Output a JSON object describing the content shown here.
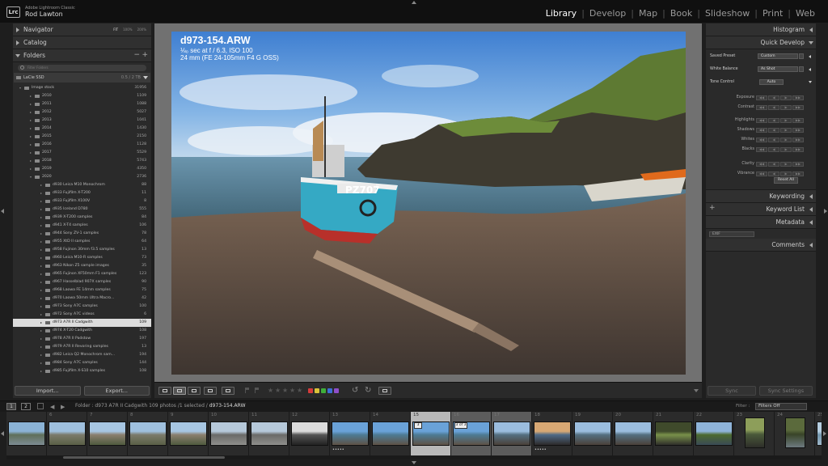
{
  "app": {
    "logo": "Lrc",
    "name": "Adobe Lightroom Classic",
    "user": "Rod Lawton"
  },
  "modules": [
    "Library",
    "Develop",
    "Map",
    "Book",
    "Slideshow",
    "Print",
    "Web"
  ],
  "active_module": "Library",
  "left_panel": {
    "navigator": {
      "label": "Navigator",
      "zoom_options": [
        "FIT",
        "100%",
        "200%"
      ]
    },
    "catalog": {
      "label": "Catalog"
    },
    "folders": {
      "label": "Folders",
      "add": "+",
      "remove": "−",
      "search_placeholder": "Filter Folders"
    },
    "drive": {
      "name": "LaCie SSD",
      "capacity": "0.5 / 2 TB"
    },
    "folder_rows": [
      {
        "name": "Image stock",
        "count": "31956",
        "depth": 1,
        "open": true
      },
      {
        "name": "2010",
        "count": "1109",
        "depth": 2
      },
      {
        "name": "2011",
        "count": "1088",
        "depth": 2
      },
      {
        "name": "2012",
        "count": "5027",
        "depth": 2
      },
      {
        "name": "2013",
        "count": "1041",
        "depth": 2
      },
      {
        "name": "2014",
        "count": "1430",
        "depth": 2
      },
      {
        "name": "2015",
        "count": "2150",
        "depth": 2
      },
      {
        "name": "2016",
        "count": "1128",
        "depth": 2
      },
      {
        "name": "2017",
        "count": "5529",
        "depth": 2
      },
      {
        "name": "2018",
        "count": "5743",
        "depth": 2
      },
      {
        "name": "2019",
        "count": "4350",
        "depth": 2
      },
      {
        "name": "2020",
        "count": "2736",
        "depth": 2,
        "open": true
      },
      {
        "name": "d930 Leica M10 Monochrom",
        "count": "88",
        "depth": 3
      },
      {
        "name": "d933 Fujifilm X-T200",
        "count": "11",
        "depth": 3
      },
      {
        "name": "d933 Fujifilm X100V",
        "count": "8",
        "depth": 3
      },
      {
        "name": "d935 Iceland D780",
        "count": "555",
        "depth": 3
      },
      {
        "name": "d939 X-T200 samples",
        "count": "84",
        "depth": 3
      },
      {
        "name": "d941 X-T4 samples",
        "count": "106",
        "depth": 3
      },
      {
        "name": "d944 Sony ZV-1 samples",
        "count": "78",
        "depth": 3
      },
      {
        "name": "d955 XtD II samples",
        "count": "64",
        "depth": 3
      },
      {
        "name": "d958 Fujinon 30mm f3.5 samples",
        "count": "13",
        "depth": 3
      },
      {
        "name": "d960 Leica M10-R samples",
        "count": "73",
        "depth": 3
      },
      {
        "name": "d963 Nikon Z5 sample images",
        "count": "35",
        "depth": 3
      },
      {
        "name": "d965 Fujinon XF50mm F1 samples",
        "count": "123",
        "depth": 3
      },
      {
        "name": "d967 Hasselblad 907X samples",
        "count": "90",
        "depth": 3
      },
      {
        "name": "d968 Laowa FE 14mm samples",
        "count": "75",
        "depth": 3
      },
      {
        "name": "d970 Laowa 50mm Ultra Macro...",
        "count": "42",
        "depth": 3
      },
      {
        "name": "d973 Sony A7C samples",
        "count": "100",
        "depth": 3
      },
      {
        "name": "d972 Sony A7C videos",
        "count": "6",
        "depth": 3
      },
      {
        "name": "d973 A7R II Cadgwith",
        "count": "109",
        "depth": 3,
        "selected": true
      },
      {
        "name": "d974 X-T20 Cadgwith",
        "count": "108",
        "depth": 3
      },
      {
        "name": "d978 A7R II Padstow",
        "count": "197",
        "depth": 3
      },
      {
        "name": "d979 A7R II Revoring samples",
        "count": "13",
        "depth": 3
      },
      {
        "name": "d982 Leica Q2 Monochrom sam...",
        "count": "194",
        "depth": 3
      },
      {
        "name": "d984 Sony A7C samples",
        "count": "144",
        "depth": 3
      },
      {
        "name": "d985 Fujifilm X-S10 samples",
        "count": "108",
        "depth": 3
      }
    ],
    "import_label": "Import...",
    "export_label": "Export..."
  },
  "loupe": {
    "filename": "d973-154.ARW",
    "exposure": "⅛₀ sec at f / 6.3, ISO 100",
    "lens": "24 mm (FE 24-105mm F4 G OSS)"
  },
  "toolbar": {
    "color_labels": [
      "#d63b3b",
      "#d9c23a",
      "#3fae3a",
      "#3d6fd6",
      "#8f4fc9"
    ]
  },
  "right_panel": {
    "histogram": "Histogram",
    "quick_develop": "Quick Develop",
    "saved_preset_label": "Saved Preset",
    "saved_preset_value": "Custom",
    "white_balance_label": "White Balance",
    "white_balance_value": "As Shot",
    "tone_control_label": "Tone Control",
    "auto_label": "Auto",
    "tone_rows": [
      "Exposure",
      "Contrast",
      "Highlights",
      "Shadows",
      "Whites",
      "Blacks",
      "Clarity",
      "Vibrance"
    ],
    "reset_label": "Reset All",
    "keywording": "Keywording",
    "keyword_list": "Keyword List",
    "metadata": "Metadata",
    "metadata_preset": "EXIF",
    "comments": "Comments",
    "sync_label": "Sync",
    "sync_settings_label": "Sync Settings"
  },
  "filmstrip_bar": {
    "screen1": "1",
    "screen2": "2",
    "folder_prefix": "Folder : d973 A7R II Cadgwith",
    "count": "109 photos /1 selected /",
    "selected_file": "d973-154.ARW",
    "filter_label": "Filter :",
    "filter_value": "Filters Off"
  },
  "filmstrip": {
    "cells": [
      {
        "num": "",
        "theme": "harbor"
      },
      {
        "num": "6",
        "theme": "village"
      },
      {
        "num": "7",
        "theme": "village2"
      },
      {
        "num": "8",
        "theme": "village"
      },
      {
        "num": "9",
        "theme": "village2"
      },
      {
        "num": "10",
        "theme": "houses"
      },
      {
        "num": "11",
        "theme": "houses"
      },
      {
        "num": "12",
        "theme": "mono"
      },
      {
        "num": "13",
        "theme": "boat",
        "dots": "•••••"
      },
      {
        "num": "14",
        "theme": "boat"
      },
      {
        "num": "15",
        "theme": "boat",
        "selected": true,
        "stack": "3"
      },
      {
        "num": "16",
        "theme": "boat",
        "grouped": true,
        "stack": "3 of 3"
      },
      {
        "num": "17",
        "theme": "beach",
        "grouped": true
      },
      {
        "num": "18",
        "theme": "sunset",
        "dots": "•••••"
      },
      {
        "num": "19",
        "theme": "beach"
      },
      {
        "num": "20",
        "theme": "beach"
      },
      {
        "num": "21",
        "theme": "cave"
      },
      {
        "num": "22",
        "theme": "headland"
      },
      {
        "num": "23",
        "theme": "portrait",
        "portrait": true
      },
      {
        "num": "24",
        "theme": "portrait2",
        "portrait": true
      },
      {
        "num": "25",
        "theme": "sea"
      }
    ]
  }
}
